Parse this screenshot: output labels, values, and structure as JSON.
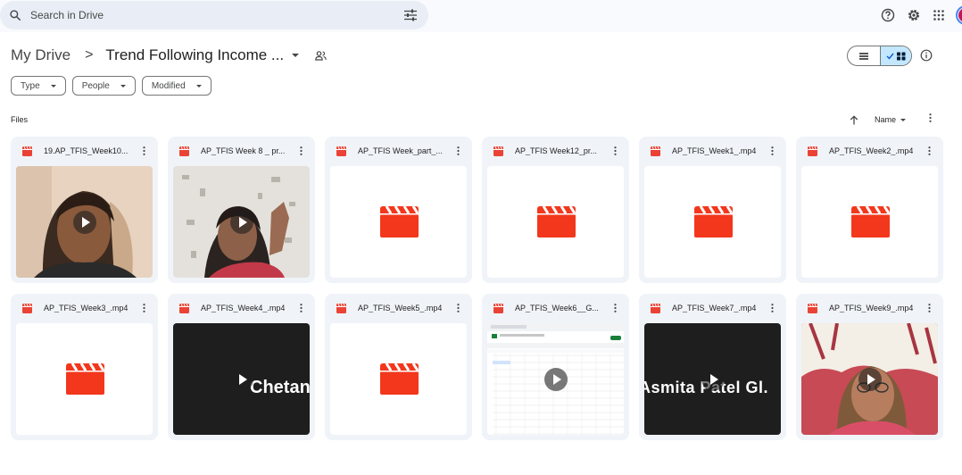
{
  "search": {
    "placeholder": "Search in Drive"
  },
  "header": {
    "breadcrumb_root": "My Drive",
    "breadcrumb_separator": ">",
    "breadcrumb_current": "Trend Following Income ..."
  },
  "filters": [
    {
      "label": "Type"
    },
    {
      "label": "People"
    },
    {
      "label": "Modified"
    }
  ],
  "section": {
    "label": "Files"
  },
  "sort": {
    "label": "Name",
    "direction": "ascending"
  },
  "view": {
    "mode": "grid"
  },
  "files": [
    {
      "name": "19.AP_TFIS_Week10...",
      "thumb": "person-beige"
    },
    {
      "name": "AP_TFIS Week 8 _ pr...",
      "thumb": "person-wall"
    },
    {
      "name": "AP_TFIS Week_part_...",
      "thumb": "video-icon"
    },
    {
      "name": "AP_TFIS Week12_pr...",
      "thumb": "video-icon"
    },
    {
      "name": "AP_TFIS_Week1_.mp4",
      "thumb": "video-icon"
    },
    {
      "name": "AP_TFIS_Week2_.mp4",
      "thumb": "video-icon"
    },
    {
      "name": "AP_TFIS_Week3_.mp4",
      "thumb": "video-icon"
    },
    {
      "name": "AP_TFIS_Week4_.mp4",
      "thumb": "dark-text",
      "overlay": "Chetan"
    },
    {
      "name": "AP_TFIS_Week5_.mp4",
      "thumb": "video-icon"
    },
    {
      "name": "AP_TFIS_Week6__G...",
      "thumb": "spreadsheet"
    },
    {
      "name": "AP_TFIS_Week7_.mp4",
      "thumb": "dark-text",
      "overlay": "Asmita Patel Gl."
    },
    {
      "name": "AP_TFIS_Week9_.mp4",
      "thumb": "person-red"
    }
  ],
  "colors": {
    "video_red": "#ea4335",
    "clapper_red": "#f2371c",
    "selected_toggle": "#c2e7ff"
  }
}
